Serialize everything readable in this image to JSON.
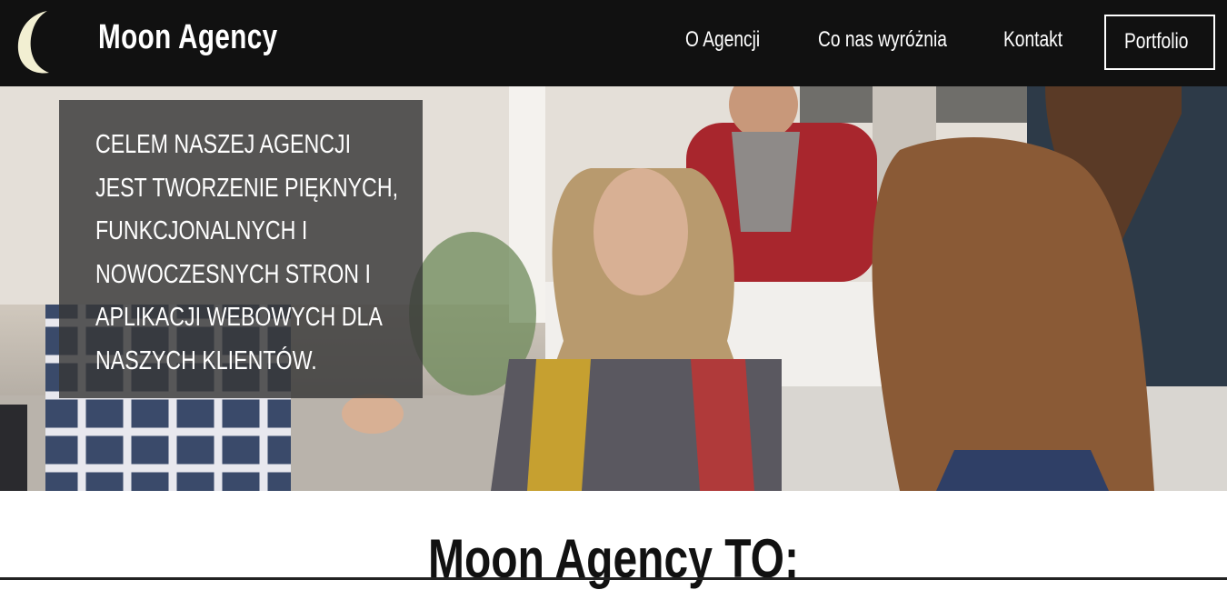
{
  "brand": {
    "name": "Moon Agency",
    "logo_icon": "crescent-moon-icon"
  },
  "nav": {
    "items": [
      {
        "label": "O Agencji"
      },
      {
        "label": "Co nas wyróżnia"
      },
      {
        "label": "Kontakt"
      }
    ],
    "portfolio_label": "Portfolio"
  },
  "hero": {
    "text": "CELEM NASZEJ AGENCJI JEST TWORZENIE PIĘKNYCH, FUNKCJONALNYCH I NOWOCZESNYCH STRON I APLIKACJI WEBOWYCH DLA NASZYCH KLIENTÓW."
  },
  "section": {
    "title": "Moon Agency TO:"
  },
  "colors": {
    "navbar": "#111111",
    "overlay": "#373737",
    "text_light": "#ffffff"
  }
}
